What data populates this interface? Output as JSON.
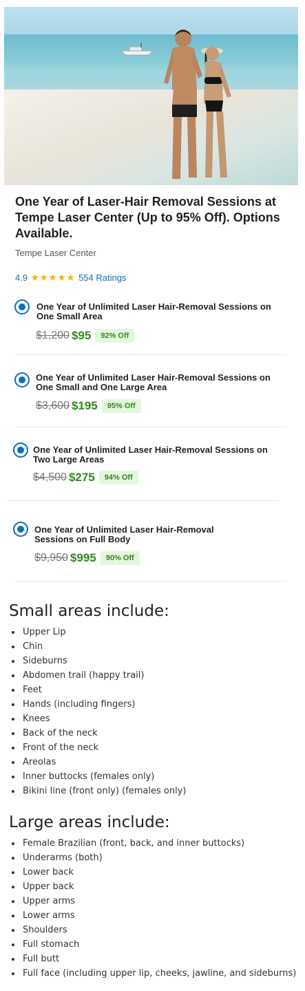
{
  "deal": {
    "title": "One Year of Laser-Hair Removal Sessions at Tempe Laser Center (Up to 95% Off). Options Available.",
    "merchant": "Tempe Laser Center",
    "rating": {
      "score": "4.9",
      "stars": 5,
      "count_label": "554 Ratings"
    },
    "image_icon": "beach-couple-photo"
  },
  "options": [
    {
      "title": "One Year of Unlimited Laser Hair-Removal Sessions on One Small Area",
      "original": "$1,200",
      "price": "$95",
      "discount": "92% Off",
      "selected": true
    },
    {
      "title": "One Year of Unlimited Laser Hair-Removal Sessions on One Small and One Large Area",
      "original": "$3,600",
      "price": "$195",
      "discount": "95% Off",
      "selected": true
    },
    {
      "title": "One Year of Unlimited Laser Hair-Removal Sessions on Two Large Areas",
      "original": "$4,500",
      "price": "$275",
      "discount": "94% Off",
      "selected": true
    },
    {
      "title": "One Year of Unlimited Laser Hair-Removal Sessions on Full Body",
      "original": "$9,950",
      "price": "$995",
      "discount": "90% Off",
      "selected": true
    }
  ],
  "small_areas": {
    "heading": "Small areas include:",
    "items": [
      "Upper Lip",
      "Chin",
      "Sideburns",
      "Abdomen trail (happy trail)",
      "Feet",
      "Hands (including fingers)",
      "Knees",
      "Back of the neck",
      "Front of the neck",
      "Areolas",
      "Inner buttocks (females only)",
      "Bikini line (front only) (females only)"
    ]
  },
  "large_areas": {
    "heading": "Large areas include:",
    "items": [
      "Female Brazilian (front, back, and inner buttocks)",
      "Underarms (both)",
      "Lower back",
      "Upper back",
      "Upper arms",
      "Lower arms",
      "Shoulders",
      "Full stomach",
      "Full butt",
      "Full face (including upper lip, cheeks, jawline, and sideburns)"
    ]
  },
  "colors": {
    "accent": "#0b6fbd",
    "price": "#2f8a1c",
    "badge_bg": "#e5f6df",
    "star": "#f2b400"
  }
}
